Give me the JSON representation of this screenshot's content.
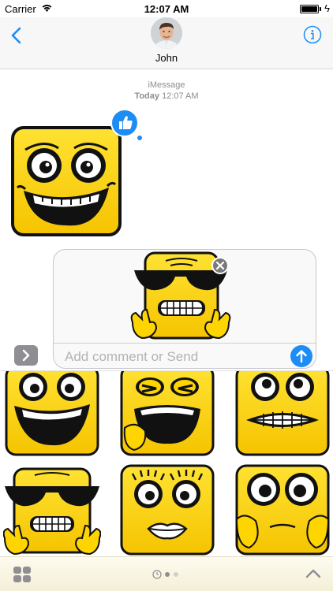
{
  "status_bar": {
    "carrier": "Carrier",
    "time": "12:07 AM",
    "battery_level": 1.0
  },
  "header": {
    "contact_name": "John",
    "back_icon": "chevron-left-icon",
    "info_icon": "info-icon"
  },
  "conversation": {
    "service": "iMessage",
    "day": "Today",
    "time": "12:07 AM",
    "tapback": "thumbs-up-icon"
  },
  "compose": {
    "placeholder": "Add comment or Send",
    "value": "",
    "send_icon": "arrow-up-icon",
    "remove_icon": "close-icon"
  },
  "drawer": {
    "stickers": [
      "grinning-square-face",
      "laughing-square-face",
      "grimacing-square-face",
      "sunglasses-peace-face",
      "lashes-lips-face",
      "worried-hands-face"
    ]
  },
  "tabbar": {
    "apps_icon": "app-grid-icon",
    "page_count": 2,
    "current_page": 0,
    "expand_icon": "chevron-up-icon"
  },
  "colors": {
    "accent": "#1e8cf5",
    "sticker_yellow": "#ffd500",
    "placeholder": "#b3b3b8"
  }
}
